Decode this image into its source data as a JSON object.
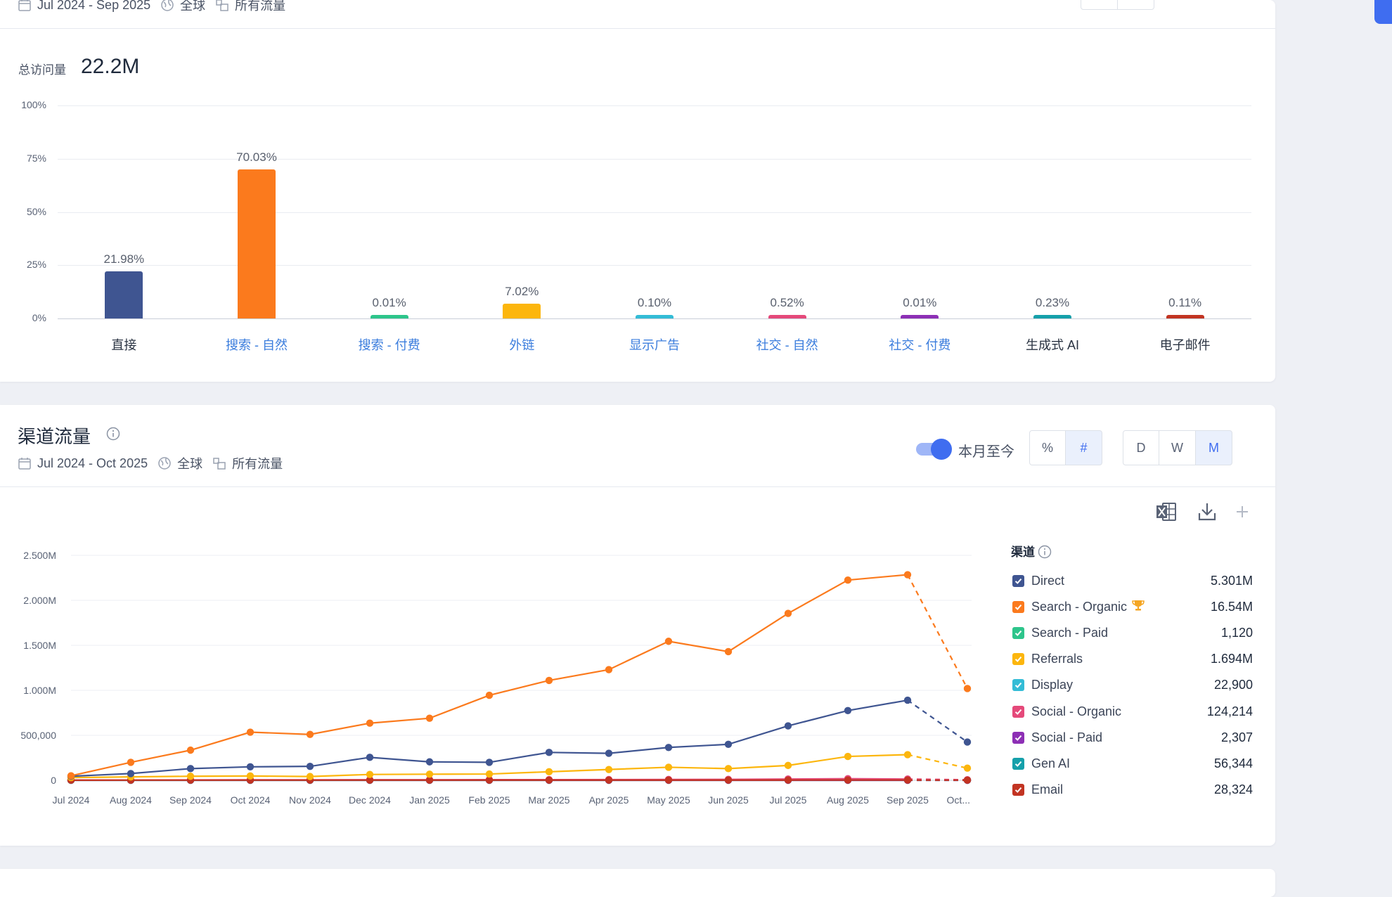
{
  "top_card": {
    "date_range": "Jul 2024 - Sep 2025",
    "region": "全球",
    "traffic_type": "所有流量",
    "total_label": "总访问量",
    "total_value": "22.2M"
  },
  "bar_chart_ticks": [
    "100%",
    "75%",
    "50%",
    "25%",
    "0%"
  ],
  "channel_card": {
    "title": "渠道流量",
    "date_range": "Jul 2024 - Oct 2025",
    "region": "全球",
    "traffic_type": "所有流量",
    "toggle_label": "本月至今",
    "toggle_on": true,
    "unit_buttons": [
      "%",
      "#"
    ],
    "unit_selected": "#",
    "granularity_buttons": [
      "D",
      "W",
      "M"
    ],
    "granularity_selected": "M",
    "legend_title": "渠道"
  },
  "chart_data": [
    {
      "type": "bar",
      "ylim": [
        0,
        100
      ],
      "yticks": [
        "100%",
        "75%",
        "50%",
        "25%",
        "0%"
      ],
      "categories": [
        "直接",
        "搜索 - 自然",
        "搜索 - 付费",
        "外链",
        "显示广告",
        "社交 - 自然",
        "社交 - 付费",
        "生成式 AI",
        "电子邮件"
      ],
      "values": [
        21.98,
        70.03,
        0.01,
        7.02,
        0.1,
        0.52,
        0.01,
        0.23,
        0.11
      ],
      "value_labels": [
        "21.98%",
        "70.03%",
        "0.01%",
        "7.02%",
        "0.10%",
        "0.52%",
        "0.01%",
        "0.23%",
        "0.11%"
      ],
      "colors": [
        "#3f5591",
        "#fb7a1d",
        "#2dc58b",
        "#fcb60d",
        "#33bcd6",
        "#e5497a",
        "#8d2fb5",
        "#15a0aa",
        "#c23422"
      ],
      "category_links": [
        false,
        true,
        true,
        true,
        true,
        true,
        true,
        false,
        false
      ]
    },
    {
      "type": "line",
      "x": [
        "Jul 2024",
        "Aug 2024",
        "Sep 2024",
        "Oct 2024",
        "Nov 2024",
        "Dec 2024",
        "Jan 2025",
        "Feb 2025",
        "Mar 2025",
        "Apr 2025",
        "May 2025",
        "Jun 2025",
        "Jul 2025",
        "Aug 2025",
        "Sep 2025",
        "Oct..."
      ],
      "ylim": [
        0,
        2500000
      ],
      "yticks": [
        "0",
        "500,000",
        "1.000M",
        "1.500M",
        "2.000M",
        "2.500M"
      ],
      "partial_last_point": true,
      "series": [
        {
          "name": "Direct",
          "total": "5.301M",
          "color": "#3f5591",
          "values": [
            45000,
            75000,
            130000,
            150000,
            155000,
            255000,
            205000,
            200000,
            310000,
            300000,
            365000,
            400000,
            605000,
            775000,
            890000,
            425000
          ]
        },
        {
          "name": "Search - Organic",
          "total": "16.54M",
          "color": "#fb7a1d",
          "trophy": true,
          "values": [
            50000,
            200000,
            335000,
            535000,
            510000,
            635000,
            690000,
            945000,
            1110000,
            1230000,
            1545000,
            1430000,
            1855000,
            2225000,
            2285000,
            1020000
          ]
        },
        {
          "name": "Search - Paid",
          "total": "1,120",
          "color": "#2dc58b",
          "values": [
            100,
            80,
            60,
            60,
            50,
            70,
            80,
            80,
            90,
            90,
            80,
            70,
            90,
            90,
            60,
            30
          ]
        },
        {
          "name": "Referrals",
          "total": "1.694M",
          "color": "#fcb60d",
          "values": [
            30000,
            38000,
            45000,
            48000,
            42000,
            65000,
            68000,
            70000,
            95000,
            120000,
            145000,
            130000,
            165000,
            265000,
            285000,
            135000
          ]
        },
        {
          "name": "Display",
          "total": "22,900",
          "color": "#33bcd6",
          "values": [
            1000,
            1200,
            1300,
            1500,
            1400,
            1500,
            1500,
            1500,
            1600,
            1700,
            1800,
            1700,
            1900,
            2000,
            1900,
            900
          ]
        },
        {
          "name": "Social - Organic",
          "total": "124,214",
          "color": "#e5497a",
          "values": [
            3000,
            3500,
            4000,
            5000,
            5000,
            6000,
            6000,
            7000,
            7500,
            8000,
            9000,
            10000,
            14000,
            18000,
            14000,
            6000
          ]
        },
        {
          "name": "Social - Paid",
          "total": "2,307",
          "color": "#8d2fb5",
          "values": [
            100,
            120,
            140,
            150,
            140,
            160,
            160,
            150,
            170,
            170,
            160,
            150,
            170,
            180,
            160,
            80
          ]
        },
        {
          "name": "Gen AI",
          "total": "56,344",
          "color": "#15a0aa",
          "values": [
            800,
            1000,
            1300,
            1600,
            1700,
            2200,
            2500,
            2700,
            3300,
            3800,
            4400,
            5000,
            6500,
            8500,
            8000,
            4000
          ]
        },
        {
          "name": "Email",
          "total": "28,324",
          "color": "#c23422",
          "values": [
            1200,
            1400,
            1500,
            1700,
            1600,
            1800,
            1800,
            1800,
            1900,
            2000,
            2000,
            2000,
            2200,
            2400,
            2300,
            1100
          ]
        }
      ]
    }
  ],
  "icons": {
    "calendar": "calendar-icon",
    "globe": "globe-icon",
    "traffic": "traffic-type-icon",
    "info": "info-icon",
    "excel": "excel-export-icon",
    "download": "download-icon",
    "add": "plus-icon",
    "trophy": "trophy-icon"
  }
}
